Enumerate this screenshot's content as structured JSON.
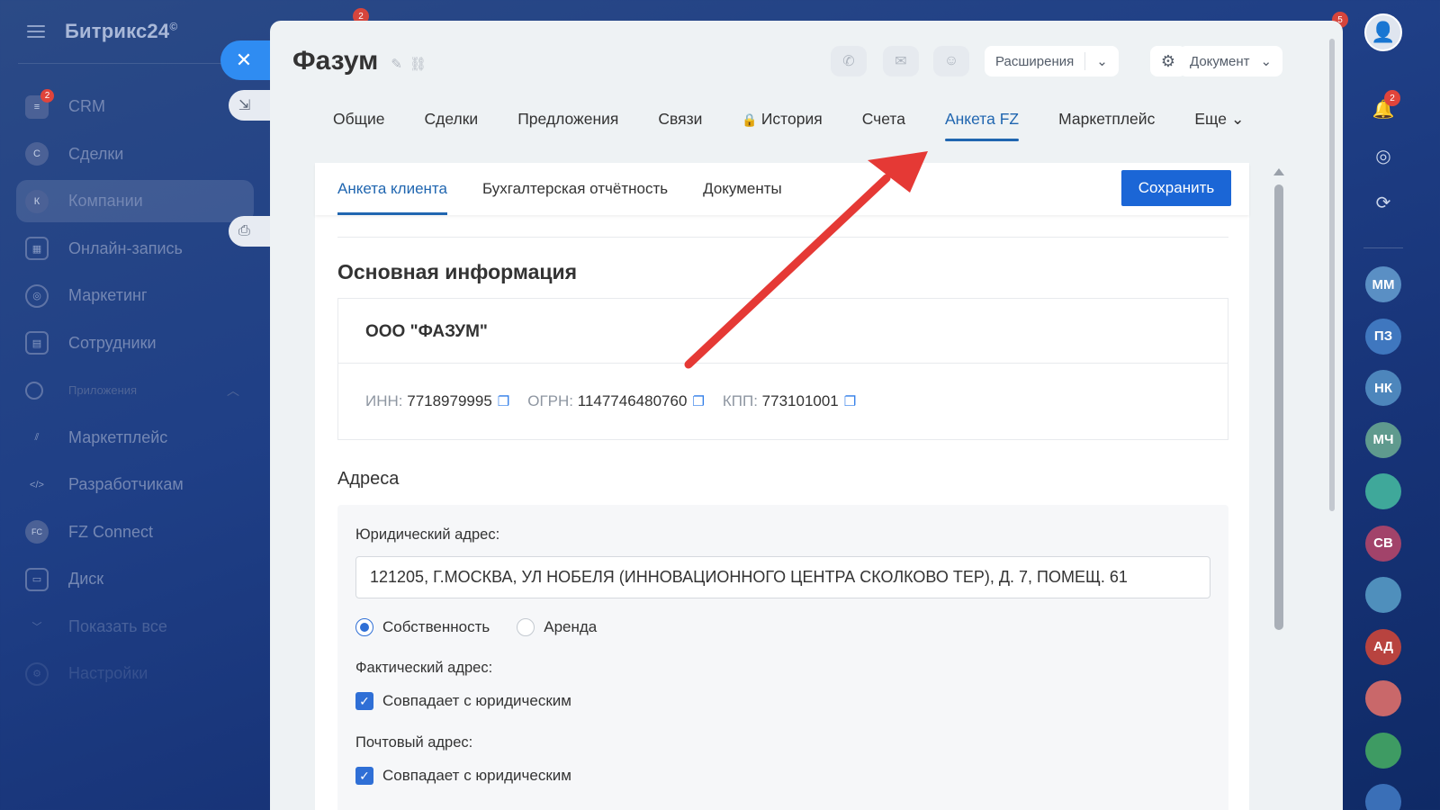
{
  "app": {
    "logo": "Битрикс24",
    "logo_mark": "©"
  },
  "sidebar": {
    "items": [
      {
        "label": "CRM",
        "badge": "2",
        "icon": "funnel-icon"
      },
      {
        "label": "Сделки",
        "icon_letter": "С"
      },
      {
        "label": "Компании",
        "icon_letter": "К",
        "active": true
      },
      {
        "label": "Онлайн-запись",
        "icon": "calendar-icon"
      },
      {
        "label": "Маркетинг",
        "icon": "target-icon"
      },
      {
        "label": "Сотрудники",
        "icon": "contacts-icon"
      },
      {
        "label": "Приложения",
        "section": true
      },
      {
        "label": "Маркетплейс",
        "icon": "market-icon"
      },
      {
        "label": "Разработчикам",
        "icon": "code-icon"
      },
      {
        "label": "FZ Connect",
        "icon_letter": "FC"
      },
      {
        "label": "Диск",
        "icon": "disk-icon"
      },
      {
        "label": "Показать все",
        "icon": "chevron-icon"
      },
      {
        "label": "Настройки",
        "icon": "settings-icon"
      }
    ]
  },
  "top_badges": {
    "left": "2",
    "right": "5"
  },
  "header": {
    "title": "Фазум",
    "extensions_label": "Расширения",
    "document_label": "Документ"
  },
  "tabs": [
    {
      "label": "Общие"
    },
    {
      "label": "Сделки"
    },
    {
      "label": "Предложения"
    },
    {
      "label": "Связи"
    },
    {
      "label": "История",
      "locked": true
    },
    {
      "label": "Счета"
    },
    {
      "label": "Анкета FZ",
      "active": true
    },
    {
      "label": "Маркетплейс"
    },
    {
      "label": "Еще"
    }
  ],
  "subtabs": [
    {
      "label": "Анкета клиента",
      "active": true
    },
    {
      "label": "Бухгалтерская отчётность"
    },
    {
      "label": "Документы"
    }
  ],
  "save_label": "Сохранить",
  "main_info": {
    "title": "Основная информация",
    "company_name": "ООО \"ФАЗУМ\"",
    "inn_label": "ИНН:",
    "inn": "7718979995",
    "ogrn_label": "ОГРН:",
    "ogrn": "1147746480760",
    "kpp_label": "КПП:",
    "kpp": "773101001"
  },
  "addresses": {
    "title": "Адреса",
    "legal_label": "Юридический адрес:",
    "legal_value": "121205, Г.МОСКВА, УЛ НОБЕЛЯ (ИННОВАЦИОННОГО ЦЕНТРА СКОЛКОВО ТЕР), Д. 7, ПОМЕЩ. 61",
    "ownership_options": [
      "Собственность",
      "Аренда"
    ],
    "ownership_selected": "Собственность",
    "actual_label": "Фактический адрес:",
    "actual_same_label": "Совпадает с юридическим",
    "actual_same": true,
    "postal_label": "Почтовый адрес:",
    "postal_same_label": "Совпадает с юридическим",
    "postal_same": true
  },
  "rail": {
    "notifications_badge": "2",
    "people": [
      {
        "initials": "ММ",
        "color": "#5a8fc4"
      },
      {
        "initials": "ПЗ",
        "color": "#3f77bf"
      },
      {
        "initials": "НК",
        "color": "#4d86bc"
      },
      {
        "initials": "МЧ",
        "color": "#5f9a8e"
      },
      {
        "initials": "",
        "color": "#3fa89a"
      },
      {
        "initials": "СВ",
        "color": "#a2436a"
      },
      {
        "initials": "",
        "color": "#4f8fbc"
      },
      {
        "initials": "АД",
        "color": "#b8433f"
      },
      {
        "initials": "",
        "color": "#c9686a"
      },
      {
        "initials": "",
        "color": "#3e9b63"
      },
      {
        "initials": "",
        "color": "#3a6fb7"
      }
    ]
  },
  "colors": {
    "accent": "#1b66d6",
    "active_tab": "#2066b0",
    "annotation_arrow": "#e53935"
  }
}
